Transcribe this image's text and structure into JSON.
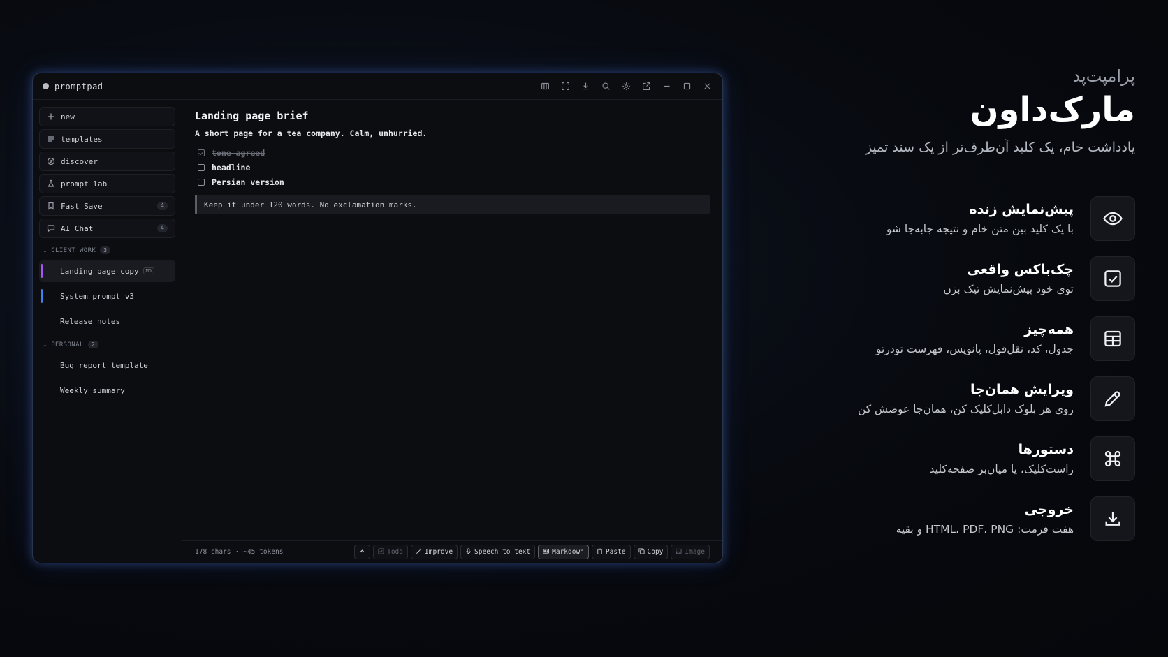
{
  "window": {
    "app_name": "promptpad",
    "toolbar_icons": [
      "layout-icon",
      "fullscreen-icon",
      "download-icon",
      "search-icon",
      "settings-icon",
      "popout-icon",
      "minimize-icon",
      "maximize-icon",
      "close-icon"
    ]
  },
  "sidebar": {
    "actions": [
      {
        "label": "new",
        "icon": "plus-icon"
      },
      {
        "label": "templates",
        "icon": "list-icon"
      },
      {
        "label": "discover",
        "icon": "compass-icon"
      },
      {
        "label": "prompt lab",
        "icon": "flask-icon"
      },
      {
        "label": "Fast Save",
        "icon": "bookmark-icon",
        "count": "4"
      },
      {
        "label": "AI Chat",
        "icon": "chat-icon",
        "count": "4"
      }
    ],
    "groups": [
      {
        "label": "CLIENT WORK",
        "count": "3",
        "items": [
          {
            "label": "Landing page copy",
            "tag": "MD",
            "active": true,
            "color": "#a855f7"
          },
          {
            "label": "System prompt v3",
            "color": "#3b82f6"
          },
          {
            "label": "Release notes"
          }
        ]
      },
      {
        "label": "PERSONAL",
        "count": "2",
        "items": [
          {
            "label": "Bug report template"
          },
          {
            "label": "Weekly summary"
          }
        ]
      }
    ]
  },
  "editor": {
    "title": "Landing page brief",
    "subtitle": "A short page for a tea company. Calm, unhurried.",
    "todos": [
      {
        "label": "tone agreed",
        "done": true
      },
      {
        "label": "headline",
        "done": false
      },
      {
        "label": "Persian version",
        "done": false
      }
    ],
    "quote": "Keep it under 120 words. No exclamation marks."
  },
  "status": {
    "chars": "178 chars",
    "sep": "·",
    "tokens": "~45 tokens",
    "actions": [
      {
        "label": "Todo",
        "icon": "check-square-icon",
        "state": "dim"
      },
      {
        "label": "Improve",
        "icon": "wand-icon"
      },
      {
        "label": "Speech to text",
        "icon": "mic-icon"
      },
      {
        "label": "Markdown",
        "icon": "markdown-icon",
        "state": "on"
      },
      {
        "label": "Paste",
        "icon": "clipboard-icon"
      },
      {
        "label": "Copy",
        "icon": "copy-icon"
      },
      {
        "label": "Image",
        "icon": "image-icon",
        "state": "dim"
      }
    ]
  },
  "panel": {
    "brand": "پرامپت‌پد",
    "title": "مارک‌داون",
    "tagline": "یادداشت خام، یک کلید آن‌طرف‌تر از یک سند تمیز",
    "features": [
      {
        "title": "پیش‌نمایش زنده",
        "desc": "با یک کلید بین متن خام و نتیجه جابه‌جا شو",
        "icon": "eye-icon"
      },
      {
        "title": "چک‌باکس واقعی",
        "desc": "توی خود پیش‌نمایش تیک بزن",
        "icon": "checkbox-icon"
      },
      {
        "title": "همه‌چیز",
        "desc": "جدول، کد، نقل‌قول، پانویس، فهرست تودرتو",
        "icon": "table-icon"
      },
      {
        "title": "ویرایش همان‌جا",
        "desc": "روی هر بلوک دابل‌کلیک کن، همان‌جا عوضش کن",
        "icon": "pencil-icon"
      },
      {
        "title": "دستورها",
        "desc": "راست‌کلیک، یا میان‌بر صفحه‌کلید",
        "icon": "command-icon"
      },
      {
        "title": "خروجی",
        "desc": "هفت فرمت: HTML، PDF، PNG و بقیه",
        "icon": "download-icon"
      }
    ]
  }
}
